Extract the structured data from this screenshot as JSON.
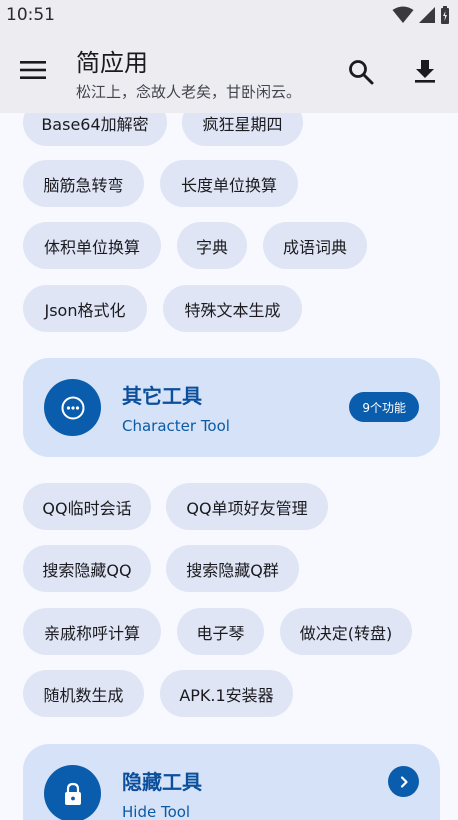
{
  "status_bar": {
    "time": "10:51"
  },
  "app_bar": {
    "title": "简应用",
    "subtitle": "松江上，念故人老矣，甘卧闲云。"
  },
  "chips_group_1": [
    "Base64加解密",
    "疯狂星期四",
    "脑筋急转弯",
    "长度单位换算",
    "体积单位换算",
    "字典",
    "成语词典",
    "Json格式化",
    "特殊文本生成"
  ],
  "other_tools": {
    "title": "其它工具",
    "subtitle": "Character Tool",
    "badge": "9个功能"
  },
  "chips_group_2": [
    "QQ临时会话",
    "QQ单项好友管理",
    "搜索隐藏QQ",
    "搜索隐藏Q群",
    "亲戚称呼计算",
    "电子琴",
    "做决定(转盘)",
    "随机数生成",
    "APK.1安装器"
  ],
  "hide_tools": {
    "title": "隐藏工具",
    "subtitle": "Hide Tool"
  },
  "colors": {
    "accent": "#0a5cad",
    "card_bg": "#d6e2f7",
    "chip_bg": "#dfe5f5",
    "app_bar_bg": "#ececf1"
  },
  "icons": {
    "menu": "menu-icon",
    "search": "search-icon",
    "download": "download-icon",
    "other_tools_avatar": "more-horizontal-icon",
    "hide_tools_avatar": "lock-icon",
    "hide_tools_arrow": "chevron-right-icon"
  }
}
